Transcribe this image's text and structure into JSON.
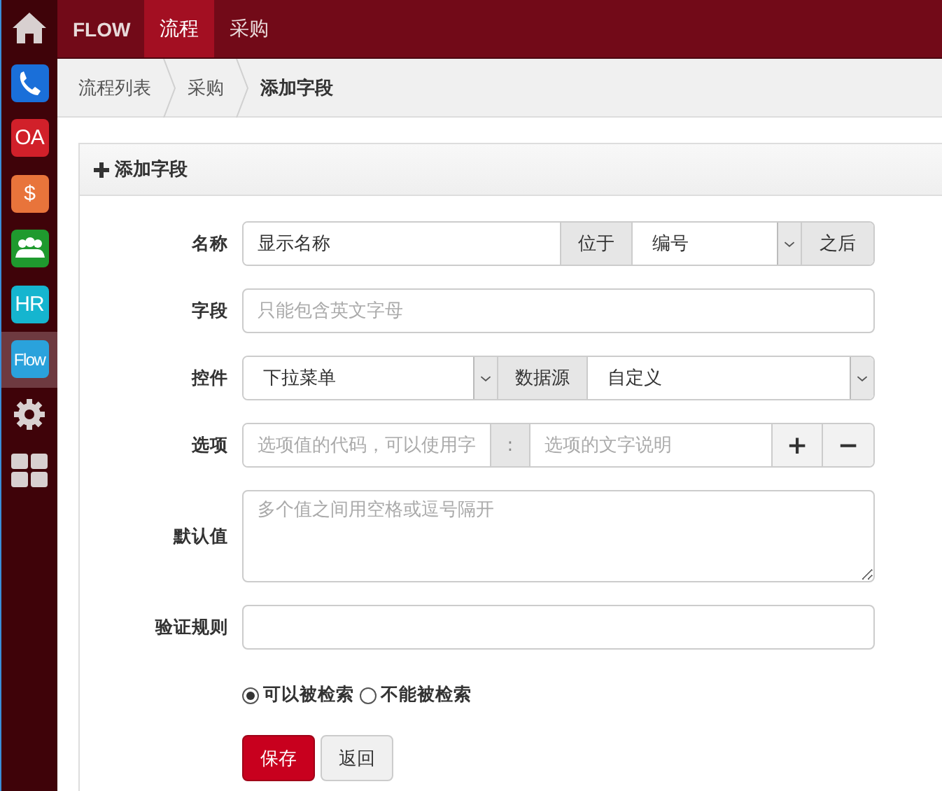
{
  "sidebar": {
    "items": [
      {
        "kind": "home",
        "selected": false
      },
      {
        "kind": "phone",
        "color": "#1a6fd9",
        "selected": false
      },
      {
        "kind": "tile",
        "label": "OA",
        "color": "#d1202a",
        "selected": false
      },
      {
        "kind": "tile",
        "label": "$",
        "color": "#e8743b",
        "selected": false
      },
      {
        "kind": "people",
        "color": "#1f9a2e",
        "selected": false
      },
      {
        "kind": "tile",
        "label": "HR",
        "color": "#15b5cf",
        "selected": false
      },
      {
        "kind": "tile",
        "label": "Flow",
        "color": "#2aa2dc",
        "selected": true
      },
      {
        "kind": "gear",
        "selected": false
      },
      {
        "kind": "grid",
        "selected": false
      }
    ]
  },
  "topbar": {
    "brand": "FLOW",
    "tabs": [
      {
        "label": "流程",
        "selected": true
      },
      {
        "label": "采购",
        "selected": false
      }
    ]
  },
  "breadcrumb": [
    {
      "label": "流程列表",
      "current": false
    },
    {
      "label": "采购",
      "current": false
    },
    {
      "label": "添加字段",
      "current": true
    }
  ],
  "panel": {
    "title": "添加字段",
    "fields": [
      {
        "kind": "name",
        "label": "名称",
        "value": "显示名称",
        "addon_before": "位于",
        "position": "编号",
        "addon_after": "之后"
      },
      {
        "kind": "text",
        "label": "字段",
        "placeholder": "只能包含英文字母"
      },
      {
        "kind": "control",
        "label": "控件",
        "select": "下拉菜单",
        "addon": "数据源",
        "source": "自定义"
      },
      {
        "kind": "options",
        "label": "选项",
        "code_placeholder": "选项值的代码，可以使用字",
        "separator": ":",
        "text_placeholder": "选项的文字说明",
        "add": "+",
        "remove": "−"
      },
      {
        "kind": "textarea",
        "label": "默认值",
        "placeholder": "多个值之间用空格或逗号隔开"
      },
      {
        "kind": "text",
        "label": "验证规则"
      }
    ],
    "radios": [
      {
        "label": "可以被检索",
        "selected": true
      },
      {
        "label": "不能被检索",
        "selected": false
      }
    ],
    "buttons": [
      {
        "label": "保存",
        "kind": "primary"
      },
      {
        "label": "返回",
        "kind": "default"
      }
    ]
  }
}
